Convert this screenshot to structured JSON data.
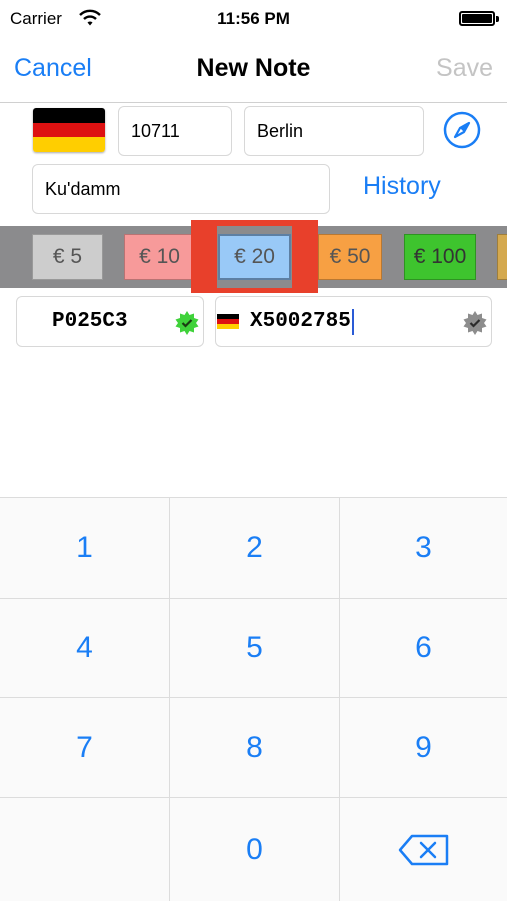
{
  "status_bar": {
    "carrier": "Carrier",
    "time": "11:56 PM"
  },
  "nav": {
    "cancel_label": "Cancel",
    "title": "New Note",
    "save_label": "Save"
  },
  "location": {
    "zip": "10711",
    "city": "Berlin",
    "street": "Ku'damm",
    "history_label": "History",
    "country_flag": "germany-flag"
  },
  "denominations": {
    "selected": "€ 20",
    "items": [
      {
        "label": "€ 5",
        "color": "#cdcdcd"
      },
      {
        "label": "€ 10",
        "color": "#f79a9a"
      },
      {
        "label": "€ 20",
        "color": "#99c9f7"
      },
      {
        "label": "€ 50",
        "color": "#f7a043"
      },
      {
        "label": "€ 100",
        "color": "#3ec42e"
      },
      {
        "label": "",
        "color": "#d4a94f"
      }
    ]
  },
  "serials": {
    "printer_code": "P025C3",
    "serial_number": "X5002785",
    "printer_status_color": "#3fd23a",
    "serial_status_color": "#888888"
  },
  "keypad": {
    "keys": [
      "1",
      "2",
      "3",
      "4",
      "5",
      "6",
      "7",
      "8",
      "9",
      "",
      "0"
    ],
    "delete_icon": "backspace-icon"
  },
  "colors": {
    "accent": "#1a7ef5",
    "selection": "#e8402b"
  }
}
